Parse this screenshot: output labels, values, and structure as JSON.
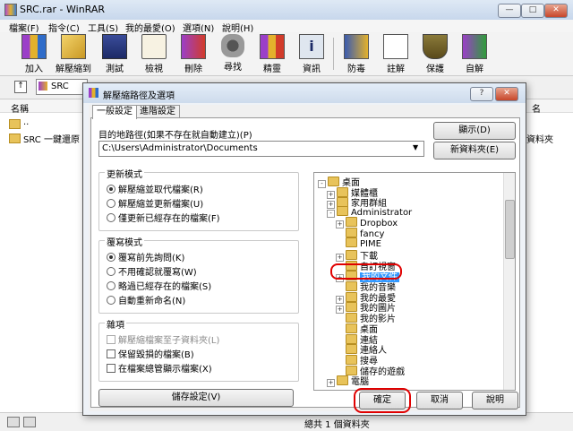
{
  "app": {
    "title": "SRC.rar - WinRAR"
  },
  "window_buttons": {
    "minimize": "—",
    "maximize": "□",
    "close": "✕"
  },
  "menu": [
    "檔案(F)",
    "指令(C)",
    "工具(S)",
    "我的最愛(O)",
    "選項(N)",
    "說明(H)"
  ],
  "toolbar": [
    {
      "label": "加入",
      "icon": "add-icon"
    },
    {
      "label": "解壓縮到",
      "icon": "extract-to-icon"
    },
    {
      "label": "測試",
      "icon": "test-icon"
    },
    {
      "label": "檢視",
      "icon": "view-icon"
    },
    {
      "label": "刪除",
      "icon": "delete-icon"
    },
    {
      "label": "尋找",
      "icon": "find-icon"
    },
    {
      "label": "精靈",
      "icon": "wizard-icon"
    },
    {
      "label": "資訊",
      "icon": "info-icon"
    },
    {
      "label": "防毒",
      "icon": "virus-scan-icon"
    },
    {
      "label": "註解",
      "icon": "comment-icon"
    },
    {
      "label": "保護",
      "icon": "protect-icon"
    },
    {
      "label": "自解",
      "icon": "sfx-icon"
    }
  ],
  "address": {
    "value": "SRC"
  },
  "filelist": {
    "column_name": "名稱",
    "column_right_partial": "名",
    "rows": [
      {
        "name": ".."
      },
      {
        "name": "SRC 一鍵還原"
      }
    ],
    "right_partial_text": "資料夾"
  },
  "statusbar": {
    "text": "總共 1 個資料夾"
  },
  "dialog": {
    "title": "解壓縮路徑及選項",
    "help_button": "?",
    "close_button": "✕",
    "tabs": [
      "一般設定",
      "進階設定"
    ],
    "dest_label": "目的地路徑(如果不存在就自動建立)(P)",
    "dest_value": "C:\\Users\\Administrator\\Documents",
    "show_button": "顯示(D)",
    "new_folder_button": "新資料夾(E)",
    "update_mode": {
      "title": "更新模式",
      "options": [
        "解壓縮並取代檔案(R)",
        "解壓縮並更新檔案(U)",
        "僅更新已經存在的檔案(F)"
      ],
      "selected": 0
    },
    "overwrite_mode": {
      "title": "覆寫模式",
      "options": [
        "覆寫前先詢問(K)",
        "不用確認就覆寫(W)",
        "略過已經存在的檔案(S)",
        "自動重新命名(N)"
      ],
      "selected": 0
    },
    "misc": {
      "title": "雜項",
      "options": [
        "解壓縮檔案至子資料夾(L)",
        "保留毀損的檔案(B)",
        "在檔案總管顯示檔案(X)"
      ],
      "disabled": [
        true,
        false,
        false
      ]
    },
    "save_button": "儲存設定(V)",
    "tree": [
      {
        "label": "桌面",
        "level": 0,
        "expander": "-"
      },
      {
        "label": "媒體櫃",
        "level": 1,
        "expander": "+"
      },
      {
        "label": "家用群組",
        "level": 1,
        "expander": "+"
      },
      {
        "label": "Administrator",
        "level": 1,
        "expander": "-"
      },
      {
        "label": "Dropbox",
        "level": 2,
        "expander": "+"
      },
      {
        "label": "fancy",
        "level": 2,
        "expander": ""
      },
      {
        "label": "PIME",
        "level": 2,
        "expander": ""
      },
      {
        "label": "下載",
        "level": 2,
        "expander": "+"
      },
      {
        "label": "自訂視窗",
        "level": 2,
        "expander": ""
      },
      {
        "label": "我的文件",
        "level": 2,
        "expander": "+"
      },
      {
        "label": "我的音樂",
        "level": 2,
        "expander": ""
      },
      {
        "label": "我的最愛",
        "level": 2,
        "expander": "+"
      },
      {
        "label": "我的圖片",
        "level": 2,
        "expander": "+"
      },
      {
        "label": "我的影片",
        "level": 2,
        "expander": ""
      },
      {
        "label": "桌面",
        "level": 2,
        "expander": ""
      },
      {
        "label": "連結",
        "level": 2,
        "expander": ""
      },
      {
        "label": "連絡人",
        "level": 2,
        "expander": ""
      },
      {
        "label": "搜尋",
        "level": 2,
        "expander": ""
      },
      {
        "label": "儲存的遊戲",
        "level": 2,
        "expander": ""
      },
      {
        "label": "電腦",
        "level": 1,
        "expander": "+"
      }
    ],
    "ok_button": "確定",
    "cancel_button": "取消",
    "help_text_button": "說明"
  },
  "colors": {
    "highlight_red": "#e00000",
    "selection_blue": "#3399ff"
  }
}
